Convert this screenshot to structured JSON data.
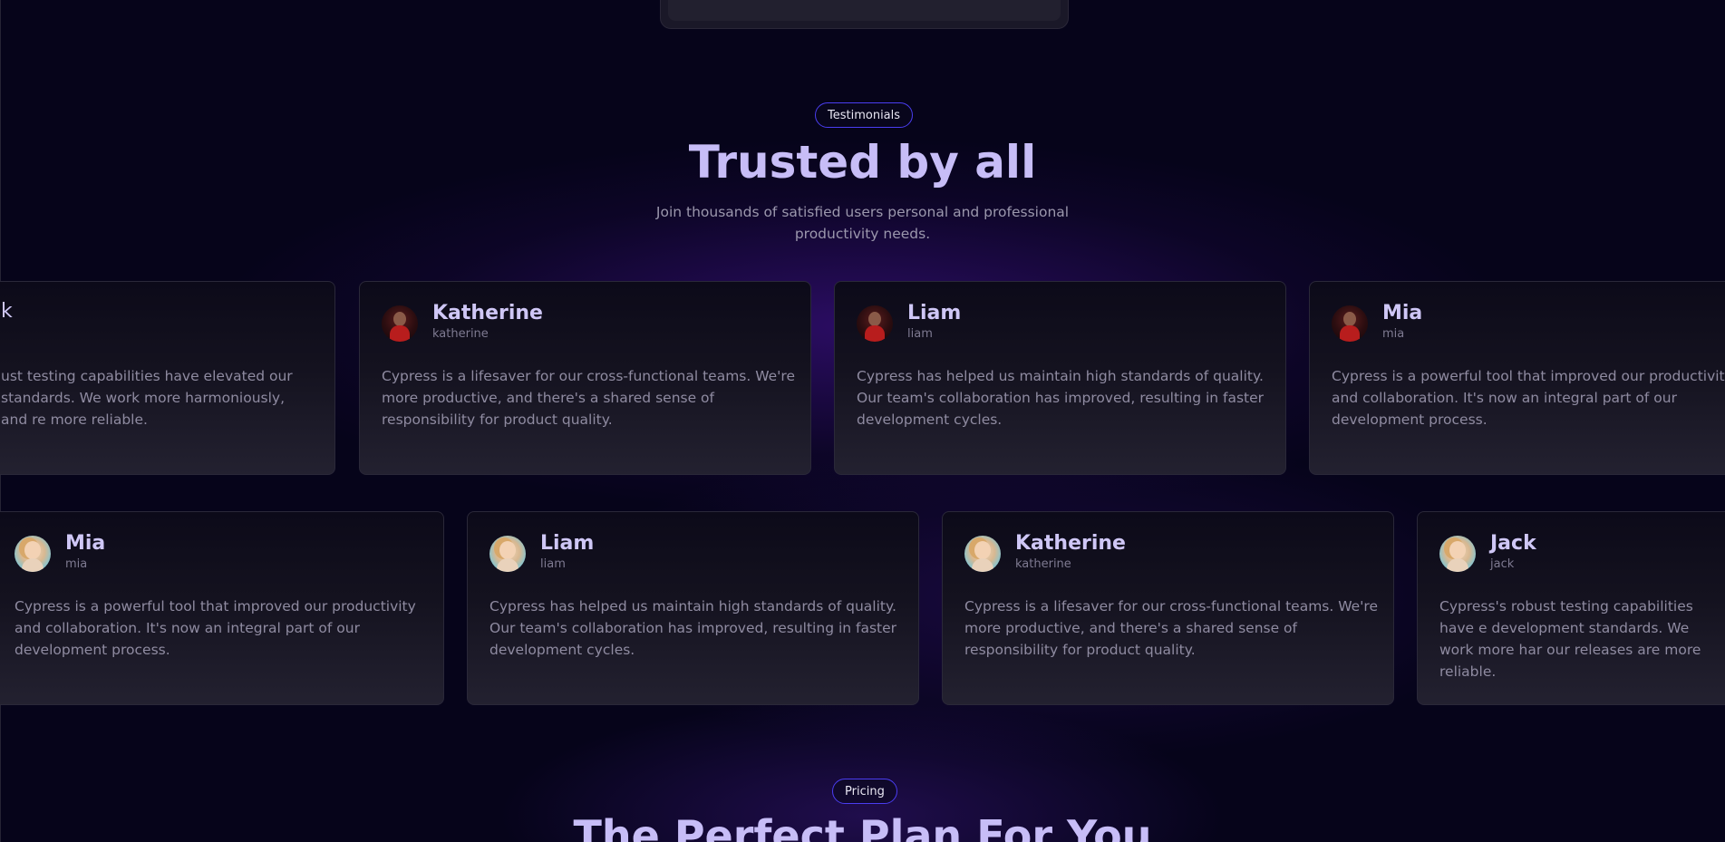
{
  "testimonials_section": {
    "badge": "Testimonials",
    "title": "Trusted by all",
    "subtitle": "Join thousands of satisfied users personal and professional productivity needs."
  },
  "row1": [
    {
      "name": "k",
      "handle": "",
      "quote": "ust testing capabilities have elevated our standards. We work more harmoniously, and re more reliable.",
      "avatar": "dark"
    },
    {
      "name": "Katherine",
      "handle": "katherine",
      "quote": "Cypress is a lifesaver for our cross-functional teams. We're more productive, and there's a shared sense of responsibility for product quality.",
      "avatar": "dark"
    },
    {
      "name": "Liam",
      "handle": "liam",
      "quote": "Cypress has helped us maintain high standards of quality. Our team's collaboration has improved, resulting in faster development cycles.",
      "avatar": "dark"
    },
    {
      "name": "Mia",
      "handle": "mia",
      "quote": "Cypress is a powerful tool that improved our productivity and collaboration. It's now an integral part of our development process.",
      "avatar": "dark"
    }
  ],
  "row2": [
    {
      "name": "Mia",
      "handle": "mia",
      "quote": "Cypress is a powerful tool that improved our productivity and collaboration. It's now an integral part of our development process.",
      "avatar": "light"
    },
    {
      "name": "Liam",
      "handle": "liam",
      "quote": "Cypress has helped us maintain high standards of quality. Our team's collaboration has improved, resulting in faster development cycles.",
      "avatar": "light"
    },
    {
      "name": "Katherine",
      "handle": "katherine",
      "quote": "Cypress is a lifesaver for our cross-functional teams. We're more productive, and there's a shared sense of responsibility for product quality.",
      "avatar": "light"
    },
    {
      "name": "Jack",
      "handle": "jack",
      "quote": "Cypress's robust testing capabilities have e development standards. We work more har our releases are more reliable.",
      "avatar": "light"
    }
  ],
  "pricing_section": {
    "badge": "Pricing",
    "title": "The Perfect Plan For You"
  }
}
